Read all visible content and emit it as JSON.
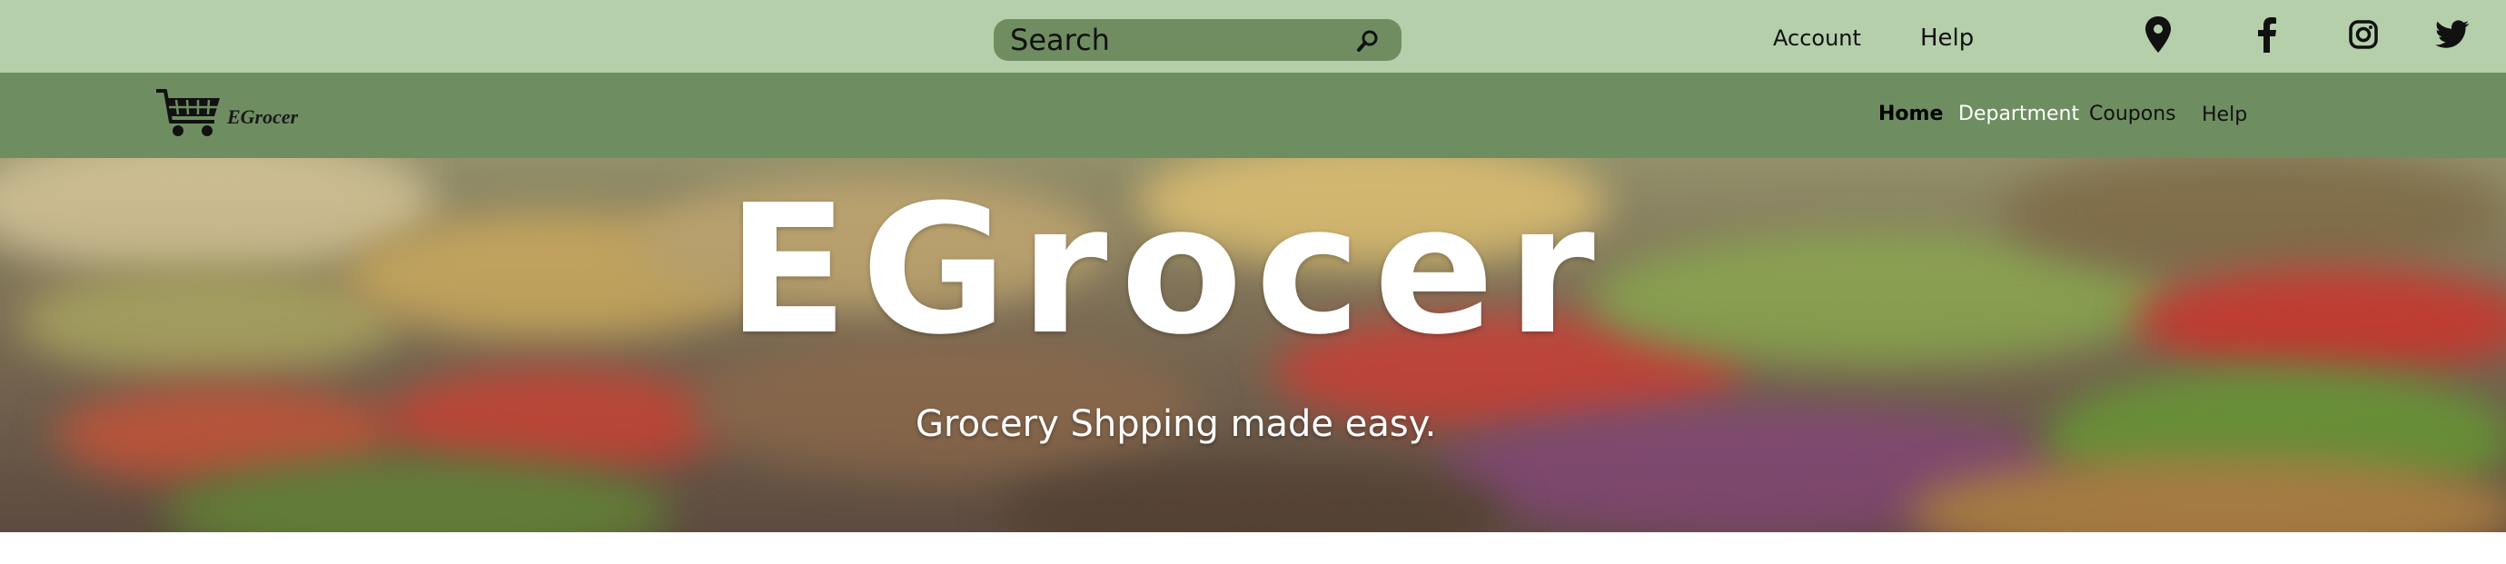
{
  "topbar": {
    "search": {
      "placeholder": "Search"
    },
    "links": {
      "account": "Account",
      "help": "Help"
    },
    "icons": [
      "location-pin-icon",
      "facebook-icon",
      "instagram-icon",
      "twitter-icon"
    ]
  },
  "navbar": {
    "logo_text": "EGrocer",
    "items": [
      {
        "label": "Home",
        "color": "#000000"
      },
      {
        "label": "Department",
        "color": "#ffffff"
      },
      {
        "label": "Coupons",
        "color": "#111111"
      },
      {
        "label": "Help",
        "color": "#111111"
      }
    ]
  },
  "hero": {
    "title": "EGrocer",
    "subtitle": "Grocery Shpping made easy."
  },
  "colors": {
    "topbar_bg": "#b4cfaa",
    "navbar_bg": "#6e8e61",
    "search_bg": "#6f8d61"
  }
}
